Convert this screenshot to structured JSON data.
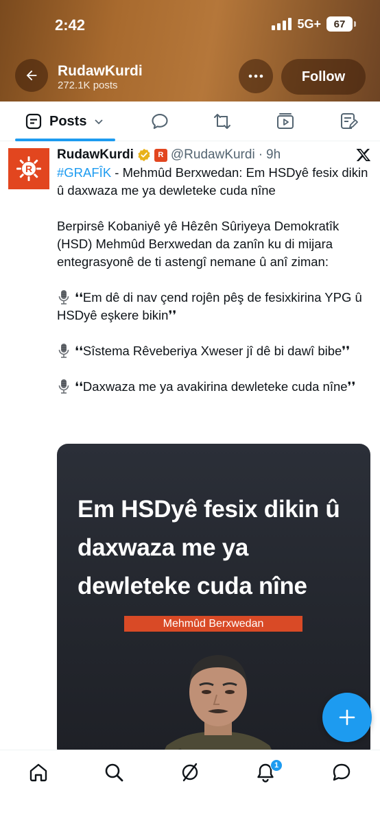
{
  "status_bar": {
    "time": "2:42",
    "network": "5G+",
    "battery": "67"
  },
  "header": {
    "profile_name": "RudawKurdi",
    "posts_count": "272.1K posts",
    "follow_label": "Follow",
    "back_icon": "back-arrow-icon",
    "more_icon": "more-icon"
  },
  "tabs": {
    "posts_label": "Posts",
    "items": [
      "posts-tab",
      "replies-tab",
      "reposts-tab",
      "videos-tab",
      "articles-tab"
    ]
  },
  "tweet": {
    "author_name": "RudawKurdi",
    "handle": "@RudawKurdi",
    "separator": "·",
    "time": "9h",
    "avatar_letter": "R",
    "hashtag": "#GRAFÎK",
    "headline": " - Mehmûd Berxwedan: Em HSDyê fesix dikin û daxwaza me ya dewleteke cuda nîne",
    "paragraph": "Berpirsê Kobaniyê yê Hêzên Sûriyeya Demokratîk (HSD) Mehmûd Berxwedan da zanîn ku di mijara entegrasyonê de ti astengî nemane û anî ziman:",
    "quote_1": "❛❛Em dê di nav çend rojên pêş de fesixkirina YPG û HSDyê eşkere bikin❜❜",
    "quote_2": "❛❛Sîstema Rêveberiya Xweser jî dê bi dawî bibe❜❜",
    "quote_3": "❛❛Daxwaza me ya avakirina dewleteke cuda nîne❜❜",
    "media": {
      "headline": "Em HSDyê fesix dikin û daxwaza me ya dewleteke cuda nîne",
      "name": "Mehmûd Berxwedan"
    }
  },
  "fab": {
    "icon": "plus-icon"
  },
  "bottom_nav": {
    "notification_count": "1"
  },
  "colors": {
    "accent": "#1d9bf0",
    "brand": "#e2461f"
  }
}
